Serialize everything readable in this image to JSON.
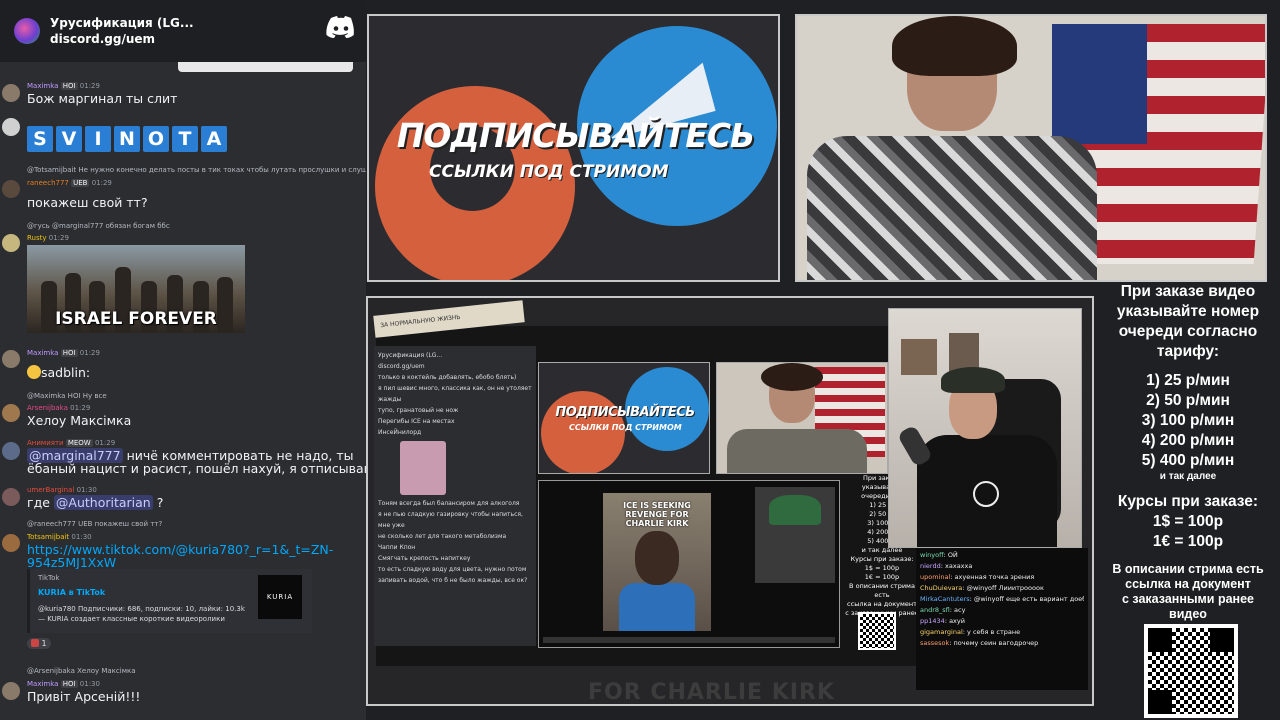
{
  "chat": {
    "server_name": "Урусификация (LG...",
    "invite": "discord.gg/uem",
    "messages": [
      {
        "author": "Maximka",
        "badge": "HOI",
        "time": "01:29",
        "text": "Бож маргинал ты слит"
      },
      {
        "author": "",
        "badge": "",
        "time": "",
        "text": "SVINOTA"
      },
      {
        "reply": "@Totsamijbait Не нужно конечно делать посты в тик токах чтобы лутать прослушки и слушате",
        "author": "raneech777",
        "badge": "UEB",
        "time": "01:29",
        "text": "покажеш свой тт?"
      },
      {
        "reply": "@гусь @marginal777 обязан богам ббс",
        "author": "Rusty",
        "badge": "",
        "time": "01:29",
        "text": "ISRAEL FOREVER"
      },
      {
        "author": "Maximka",
        "badge": "HOI",
        "time": "01:29",
        "text": "sadblin:"
      },
      {
        "reply": "@Maximka HOI Ну все",
        "author": "Arsenijbaka",
        "badge": "",
        "time": "01:29",
        "text": "Хелоу Максімка"
      },
      {
        "author": "Анимияти",
        "badge": "MEOW",
        "time": "01:29",
        "mention": "@marginal777",
        "text": "ничё комментировать не надо, ты",
        "text2": "ёбаный нацист и расист, пошёл нахуй, я отписываюсь"
      },
      {
        "author": "umerBarginal",
        "badge": "",
        "time": "01:30",
        "text": "где",
        "mention": "@Authoritarian",
        "text_end": "?"
      },
      {
        "reply": "@raneech777 UEB покажеш свой тт?",
        "author": "Totsamijbait",
        "badge": "",
        "time": "01:30",
        "link": "https://www.tiktok.com/@kuria780?_r=1&_t=ZN-",
        "link2": "954z5MJ1XxW"
      },
      {
        "reply": "@Arsenijbaka Хелоу Максімка",
        "author": "Maximka",
        "badge": "HOI",
        "time": "01:30",
        "text": "Привіт Арсеній!!!"
      }
    ],
    "embed": {
      "source": "TikTok",
      "title": "KURIA в TikTok",
      "description": "@kuria780 Подписчики: 686, подписки: 10, лайки: 10.3k — KURIA создает классные короткие видеоролики",
      "thumb": "KURIA"
    },
    "reaction_count": "1"
  },
  "promo": {
    "title": "ПОДПИСЫВАЙТЕСЬ",
    "subtitle": "ССЫЛКИ ПОД СТРИМОМ"
  },
  "nested": {
    "tape_text": "ЗА НОРМАЛЬНУЮ ЖИЗНЬ",
    "chat_lines": [
      "Урусификация (LG...",
      "discord.gg/uem",
      "только в коктейль добавлять, ебобо блять)",
      "я пил шевис много, классика как, он не утоляет жажды",
      "тупо, гранатовый не нож",
      "Перегибы ICE на местах",
      "ИнсеЙнилорд",
      "Тоням всегда был балансиром для алкоголя",
      "я не пью сладкую газировку чтобы напиться, мне уже",
      "не сколько лет для такого метаболизма",
      "Чаппи Кпон",
      "Смягчать крепость напиткеу",
      "то есть сладкую воду для цвета, нужно потом",
      "запивать водой, что б не было жажды, все ок?"
    ],
    "promo_title": "ПОДПИСЫВАЙТЕСЬ",
    "promo_sub": "ССЫЛКИ ПОД СТРИМОМ",
    "video_caption": "ICE IS SEEKING REVENGE FOR CHARLIE KIRK",
    "side_lines": [
      "При заказе",
      "указывайте",
      "очереди сог",
      "1) 25 р/",
      "2) 50 р/",
      "3) 100 р/",
      "4) 200 р/",
      "5) 400 р/",
      "и так далее",
      "Курсы при заказе:",
      "1$ = 100р",
      "1€ = 100р",
      "В описании стрима есть",
      "ссылка на документ",
      "с заказанными ранее",
      "видео"
    ],
    "chat2": [
      {
        "user": "winyoff",
        "text": "ОЙ"
      },
      {
        "user": "nierdd",
        "text": "хахахха"
      },
      {
        "user": "upominal",
        "text": "ахуенная точка зрения"
      },
      {
        "user": "ChuDuievara",
        "text": "@winyoff Лииитроооок"
      },
      {
        "user": "MirkaCantuters",
        "text": "@winyoff еще есть вариант доеб полиции, типа че ты пиздек после 10 зароебишься"
      },
      {
        "user": "andr8_sfl",
        "text": "асу"
      },
      {
        "user": "pp1434",
        "text": "ахуй"
      },
      {
        "user": "gigamarginal",
        "text": "у себя в стране"
      },
      {
        "user": "sassesok",
        "text": "почему сеин вагодрочер"
      }
    ],
    "ghost": "FOR CHARLIE KIRK"
  },
  "info": {
    "head": [
      "При заказе видео",
      "указывайте номер",
      "очереди согласно",
      "тарифу:"
    ],
    "tariffs": [
      "1) 25 р/мин",
      "2) 50 р/мин",
      "3) 100 р/мин",
      "4) 200 р/мин",
      "5) 400 р/мин"
    ],
    "etc": "и так далее",
    "courses_head": "Курсы при заказе:",
    "courses": [
      "1$ = 100р",
      "1€ = 100р"
    ],
    "doc": [
      "В описании стрима есть",
      "ссылка на документ",
      "с заказанными ранее",
      "видео"
    ]
  }
}
